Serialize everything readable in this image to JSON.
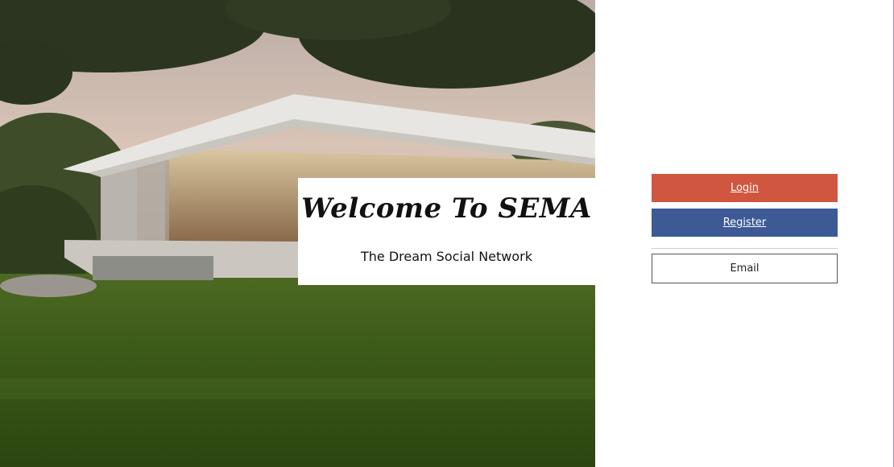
{
  "hero": {
    "title": "Welcome To SEMA",
    "subtitle": "The Dream Social Network"
  },
  "auth": {
    "login_label": "Login",
    "register_label": "Register",
    "email_label": "Email"
  },
  "colors": {
    "login": "#d05640",
    "register": "#3d5a96"
  }
}
